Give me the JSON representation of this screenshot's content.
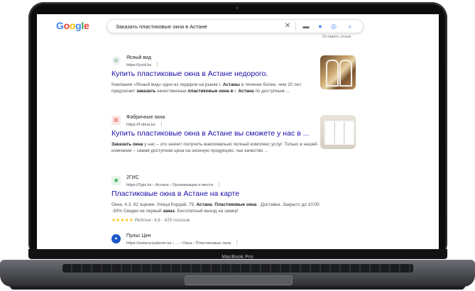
{
  "device": {
    "brand": "MacBook Pro"
  },
  "search": {
    "logo_letters": [
      "G",
      "o",
      "o",
      "g",
      "l",
      "e"
    ],
    "query": "Заказать пластиковые окна в Астане"
  },
  "partial_link": "Оставить отзыв",
  "results": [
    {
      "favicon": "◎",
      "site_name": "Ясный вид",
      "url": "https://yvid.kz",
      "title": "Купить пластиковые окна в Астане недорого.",
      "snippet_html": "Компания «Ясный вид» один из лидеров на рынке г. <b>Астаны</b> в течение более, чем 20 лет, предлагает <b>заказать</b> качественные <b>пластиковые окна в</b> г. <b>Астана</b> по доступным ..."
    },
    {
      "favicon": "▤",
      "site_name": "Фабричные окна",
      "url": "https://f-okna.kz",
      "title": "Купить пластиковые окна в Астане вы сможете у нас в ...",
      "snippet_html": "<b>Заказать окна</b> у нас – это значит получить максимально полный комплекс услуг. Только в нашей компании – самая доступная цена на оконную продукцию, чье качество ..."
    },
    {
      "favicon": "◉",
      "site_name": "2ГИС",
      "url": "https://2gis.kz › Астана › Организации и места",
      "title": "Пластиковые окна в Астане на карте",
      "snippet_html": "Окна. 4.3. 62 оценки. Улица Кордай, 79, <b>Астана</b>. <b>Пластиковые окна</b> · Доставка. Закрыто до 10:00. -30% Скидки на первый <b>заказ</b>. Бесплатный выезд на замер!",
      "stars": "★★★★★",
      "rating_text": "Рейтинг: 4,6 · 425 голосов"
    },
    {
      "favicon": "▲",
      "site_name": "Пульс Цен",
      "url": "https://astana.pulscen.kz › ... › Окна › Пластиковые окна"
    }
  ],
  "colors": {
    "link": "#1a0dab",
    "accent": "#4285f4",
    "star": "#fbbc04"
  },
  "icons": [
    "clear-icon",
    "keyboard-icon",
    "mic-icon",
    "lens-icon",
    "search-icon",
    "more-vert-icon"
  ]
}
